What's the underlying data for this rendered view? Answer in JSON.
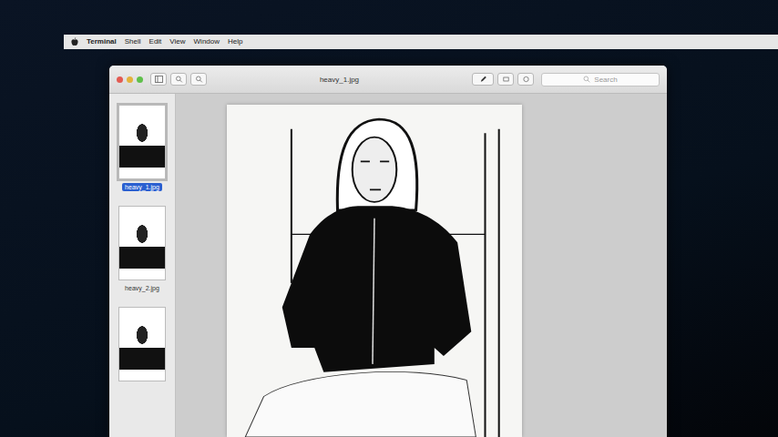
{
  "menu_bar": {
    "items": [
      {
        "label": "Terminal",
        "selected": true
      },
      {
        "label": "Shell",
        "selected": false
      },
      {
        "label": "Edit",
        "selected": false
      },
      {
        "label": "View",
        "selected": false
      },
      {
        "label": "Window",
        "selected": false
      },
      {
        "label": "Help",
        "selected": false
      }
    ]
  },
  "window": {
    "title": "heavy_1.jpg"
  },
  "toolbar": {
    "search": {
      "placeholder": "Search"
    }
  },
  "sidebar": {
    "items": [
      {
        "label": "heavy_1.jpg",
        "selected": true
      },
      {
        "label": "heavy_2.jpg",
        "selected": false
      },
      {
        "label": "",
        "selected": false
      }
    ]
  }
}
